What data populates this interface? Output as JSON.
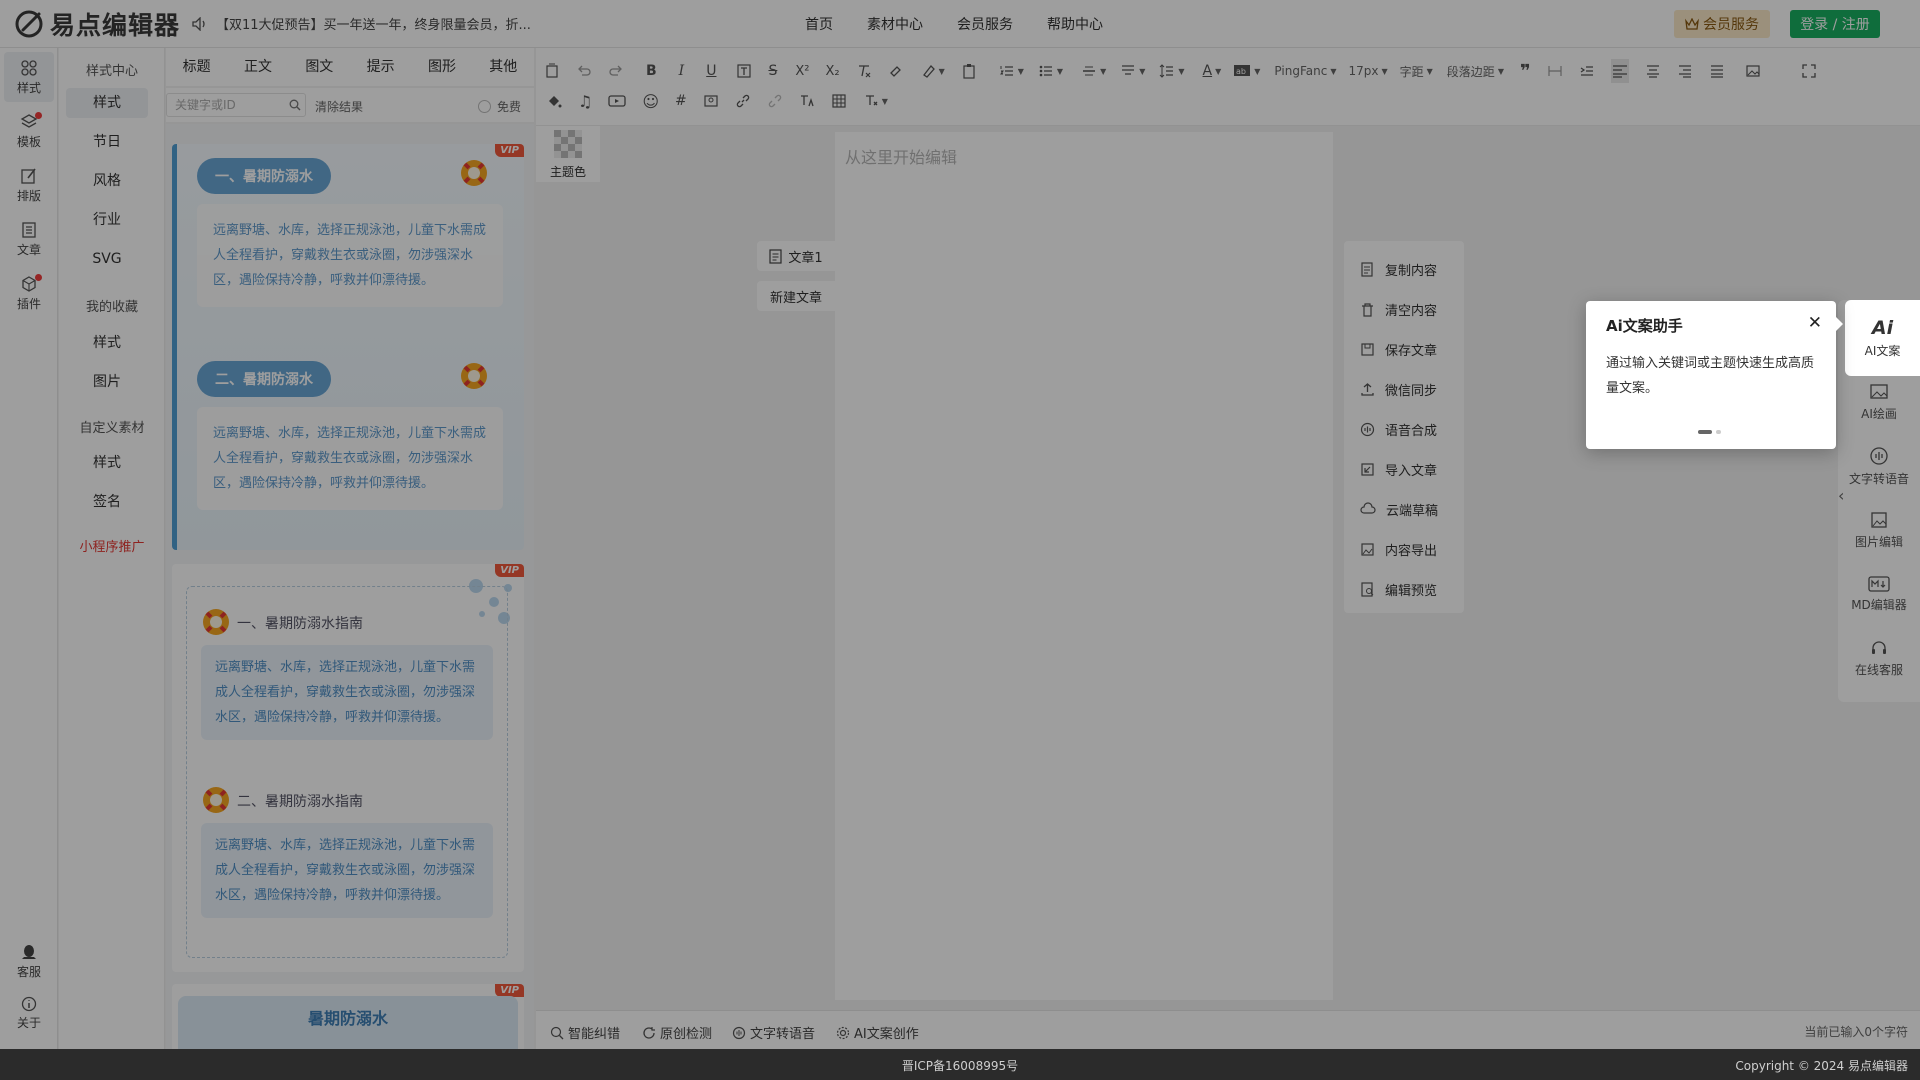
{
  "header": {
    "logo_text": "易点编辑器",
    "notice": "【双11大促预告】买一年送一年，终身限量会员，折...",
    "nav": [
      "首页",
      "素材中心",
      "会员服务",
      "帮助中心"
    ],
    "vip_button": "会员服务",
    "login_button": "登录 / 注册"
  },
  "rail": {
    "items": [
      "样式",
      "模板",
      "排版",
      "文章",
      "插件"
    ],
    "bottom": [
      "客服",
      "关于"
    ]
  },
  "categories": {
    "head1": "样式中心",
    "group1": [
      "样式",
      "节日",
      "风格",
      "行业",
      "SVG"
    ],
    "head2": "我的收藏",
    "group2": [
      "样式",
      "图片"
    ],
    "head3": "自定义素材",
    "group3": [
      "样式",
      "签名"
    ],
    "promo": "小程序推广"
  },
  "style_tabs": [
    "标题",
    "正文",
    "图文",
    "提示",
    "图形",
    "其他"
  ],
  "search": {
    "placeholder": "关键字或ID",
    "clear": "清除结果",
    "free": "免费"
  },
  "cards": {
    "vip": "VIP",
    "c1_title1": "一、暑期防溺水",
    "c1_title2": "二、暑期防溺水",
    "body": "远离野塘、水库，选择正规泳池，儿童下水需成人全程看护，穿戴救生衣或泳圈，勿涉强深水区，遇险保持冷静，呼救并仰漂待援。",
    "c2_title1": "一、暑期防溺水指南",
    "c2_title2": "二、暑期防溺水指南",
    "c3_title": "暑期防溺水"
  },
  "toolbar": {
    "font": "PingFanc",
    "size": "17px",
    "spacing": "字距",
    "margin": "段落边距"
  },
  "theme_label": "主题色",
  "editor": {
    "placeholder": "从这里开始编辑",
    "doc_tab": "文章1",
    "new_doc": "新建文章"
  },
  "actions": [
    "复制内容",
    "清空内容",
    "保存文章",
    "微信同步",
    "语音合成",
    "导入文章",
    "云端草稿",
    "内容导出",
    "编辑预览"
  ],
  "bottom_bar": {
    "items": [
      "智能纠错",
      "原创检测",
      "文字转语音",
      "AI文案创作"
    ],
    "count": "当前已输入0个字符"
  },
  "right_rail": {
    "ai_big": "Ai",
    "items": [
      "AI文案",
      "AI绘画",
      "文字转语音",
      "图片编辑",
      "MD编辑器",
      "在线客服"
    ]
  },
  "popup": {
    "title": "Ai文案助手",
    "close": "✕",
    "body": "通过输入关键词或主题快速生成高质量文案。"
  },
  "footer": {
    "icp": "晋ICP备16008995号",
    "copyright": "Copyright © 2024 易点编辑器"
  },
  "colors": {
    "brand_green": "#19b061",
    "vip_orange": "#f05a3c",
    "accent_blue": "#4f9ed4"
  }
}
